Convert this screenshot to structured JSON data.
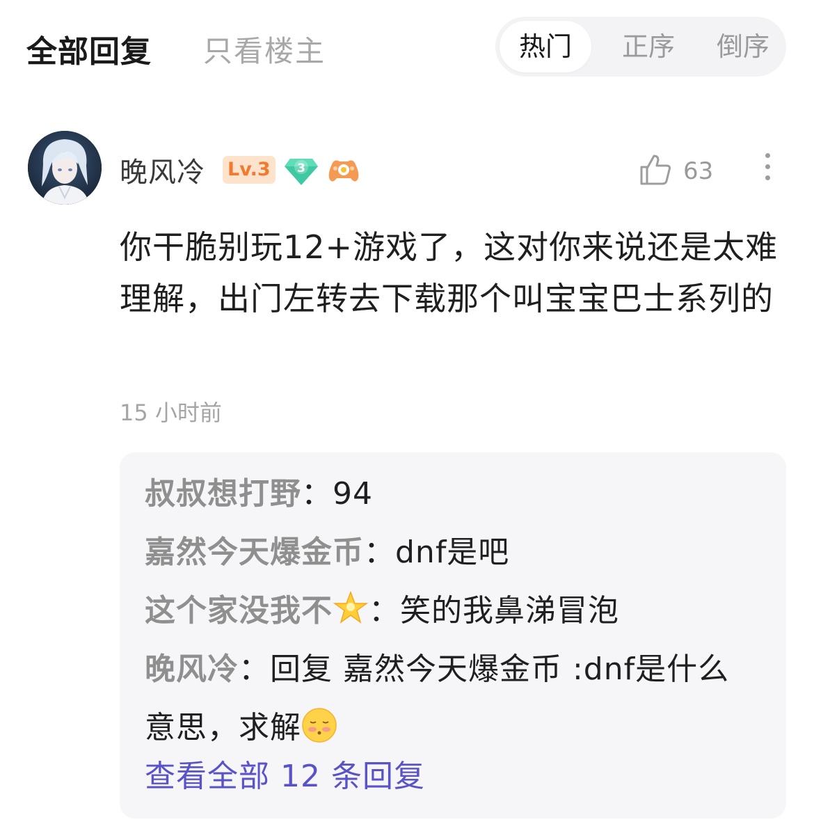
{
  "header": {
    "tab_all": "全部回复",
    "tab_op_only": "只看楼主",
    "sort_options": [
      "热门",
      "正序",
      "倒序"
    ]
  },
  "comment": {
    "username": "晚风冷",
    "level": "Lv.3",
    "gem_level": "3",
    "likes": "63",
    "text": "你干脆别玩12+游戏了，这对你来说还是太难理解，出门左转去下载那个叫宝宝巴士系列的",
    "time": "15 小时前"
  },
  "replies": [
    {
      "author": "叔叔想打野",
      "sep": "：",
      "text": "94"
    },
    {
      "author": "嘉然今天爆金币",
      "sep": "：",
      "text": "dnf是吧"
    },
    {
      "author": "这个家没我不",
      "sep": "：",
      "text": "笑的我鼻涕冒泡",
      "author_emoji": "star-emoji"
    },
    {
      "author": "晚风冷",
      "sep": "：",
      "text": "回复 嘉然今天爆金币 :dnf是什么意思，求解",
      "text_emoji": "blush-face-emoji"
    }
  ],
  "view_all_label": "查看全部 12 条回复",
  "colors": {
    "link": "#5a53c8",
    "level_badge_bg": "#fde3cc",
    "level_badge_text": "#ef7b30",
    "gem": "#3ec9a2"
  }
}
